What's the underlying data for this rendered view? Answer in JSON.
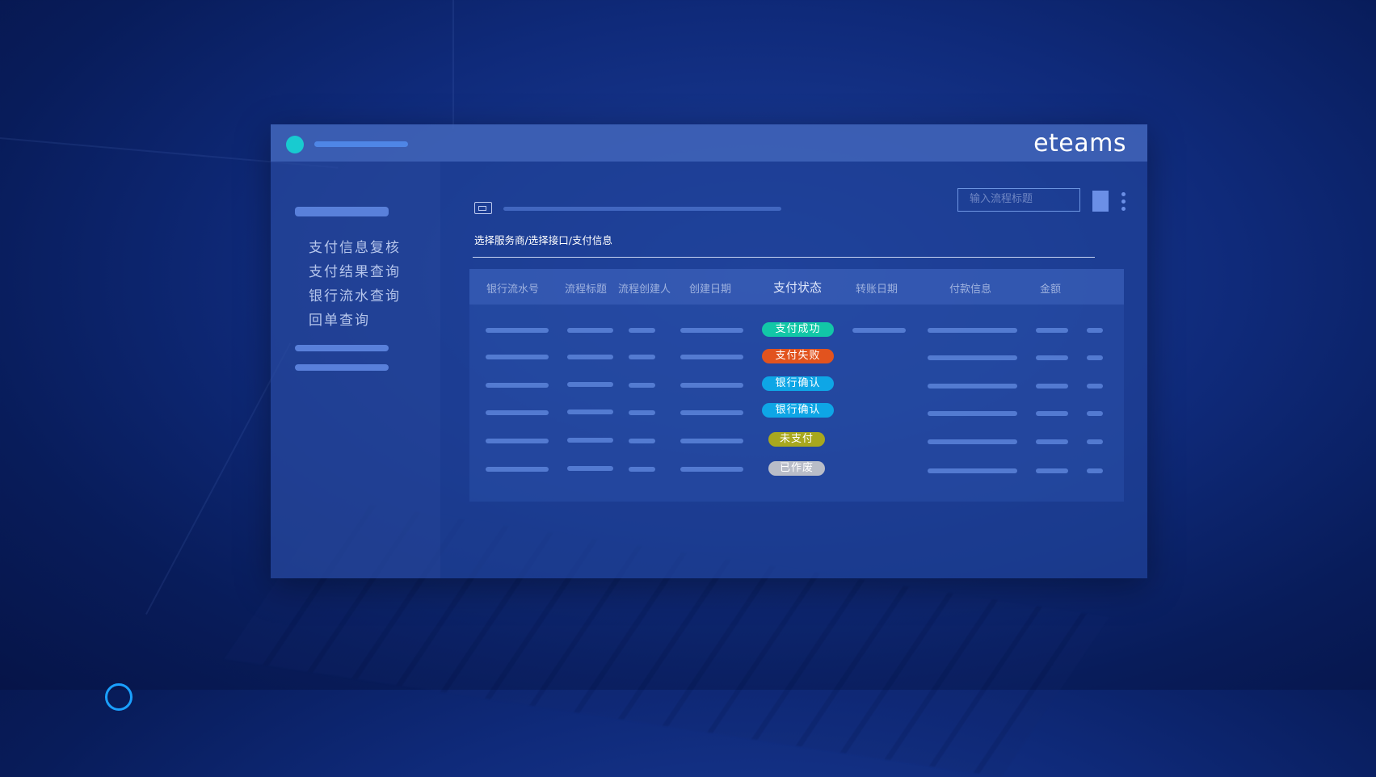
{
  "window": {
    "logo_text": "eteams"
  },
  "sidebar": {
    "items": [
      {
        "label": "支付信息复核"
      },
      {
        "label": "支付结果查询"
      },
      {
        "label": "银行流水查询"
      },
      {
        "label": "回单查询"
      }
    ]
  },
  "main": {
    "search_placeholder": "输入流程标题",
    "breadcrumb": "选择服务商/选择接口/支付信息",
    "table": {
      "headers": [
        "银行流水号",
        "流程标题",
        "流程创建人",
        "创建日期",
        "支付状态",
        "转账日期",
        "付款信息",
        "金额"
      ],
      "status_badges": [
        {
          "label": "支付成功",
          "color": "#12c7a7"
        },
        {
          "label": "支付失败",
          "color": "#e2531e"
        },
        {
          "label": "银行确认",
          "color": "#0ea6e6"
        },
        {
          "label": "银行确认",
          "color": "#0ea6e6"
        },
        {
          "label": "未支付",
          "color": "#a8a81e"
        },
        {
          "label": "已作废",
          "color": "#b9bdc8"
        }
      ]
    }
  },
  "icons": [
    "app-status-dot-icon",
    "document-icon",
    "more-vertical-icon"
  ]
}
